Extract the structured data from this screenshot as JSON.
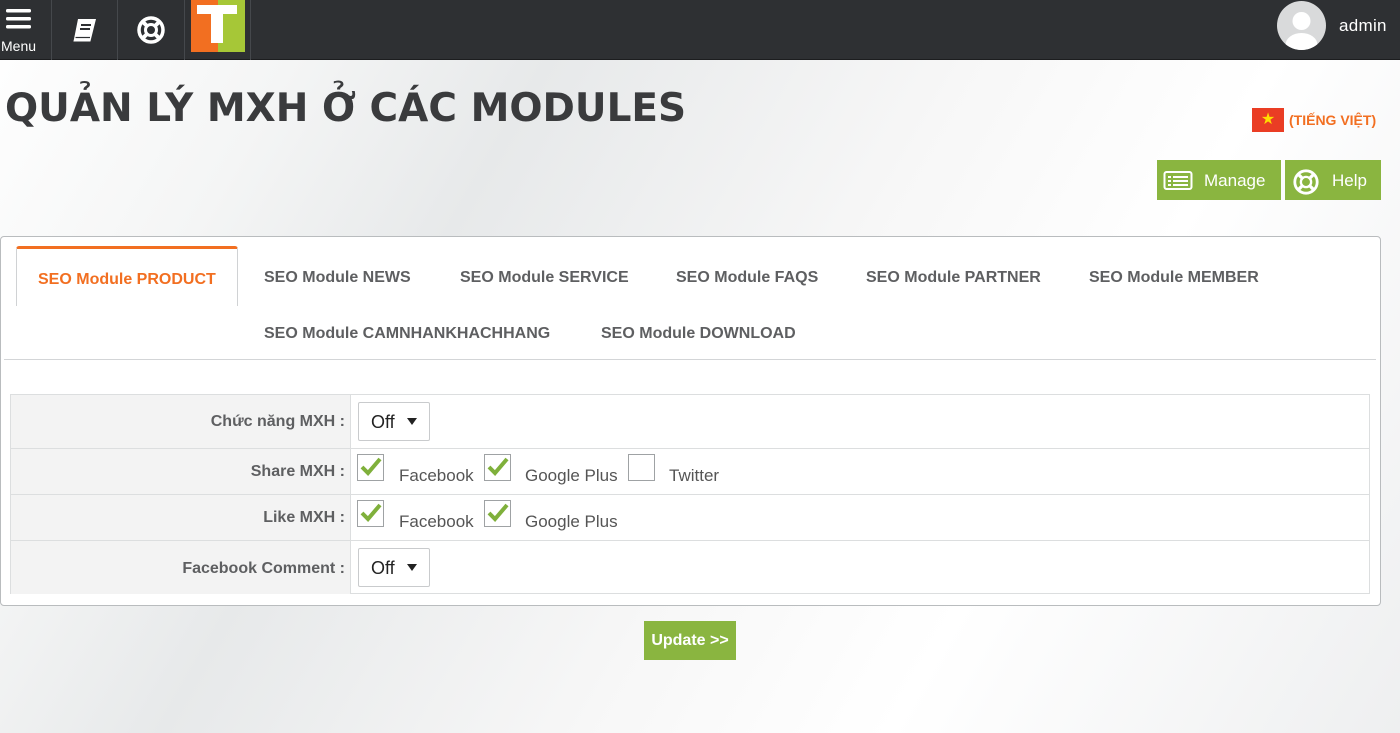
{
  "topbar": {
    "menu_label": "Menu",
    "user_name": "admin",
    "logo_letter": "T"
  },
  "page": {
    "title": "QUẢN LÝ MXH Ở CÁC MODULES",
    "language": "(TIẾNG VIỆT)",
    "manage_label": "Manage",
    "help_label": "Help"
  },
  "tabs": [
    {
      "label": "SEO Module PRODUCT",
      "active": true
    },
    {
      "label": "SEO Module NEWS"
    },
    {
      "label": "SEO Module SERVICE"
    },
    {
      "label": "SEO Module FAQS"
    },
    {
      "label": "SEO Module PARTNER"
    },
    {
      "label": "SEO Module MEMBER"
    },
    {
      "label": "SEO Module CAMNHANKHACHHANG"
    },
    {
      "label": "SEO Module DOWNLOAD"
    }
  ],
  "form": {
    "social_function": {
      "label": "Chức năng MXH :",
      "value": "Off"
    },
    "share": {
      "label": "Share MXH :",
      "options": [
        {
          "label": "Facebook",
          "checked": true
        },
        {
          "label": "Google Plus",
          "checked": true
        },
        {
          "label": "Twitter",
          "checked": false
        }
      ]
    },
    "like": {
      "label": "Like MXH :",
      "options": [
        {
          "label": "Facebook",
          "checked": true
        },
        {
          "label": "Google Plus",
          "checked": true
        }
      ]
    },
    "facebook_comment": {
      "label": "Facebook Comment :",
      "value": "Off"
    }
  },
  "update_label": "Update >>",
  "colors": {
    "topbar": "#2e3033",
    "accent_orange": "#f26f21",
    "accent_green": "#8ab540"
  }
}
